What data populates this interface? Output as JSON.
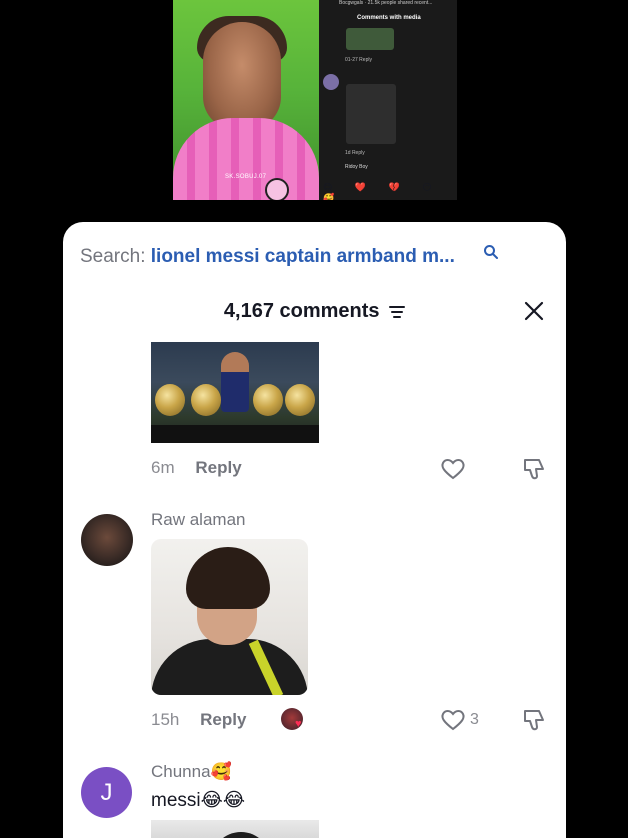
{
  "video": {
    "watermark": "SK.SOBUJ.07",
    "right_panel": {
      "top_text": "Bocgwgals · 21.5k people shared recent...",
      "title": "Comments with media",
      "meta_1": "01-27   Reply",
      "meta_2": "1d   Reply",
      "emoji_row": "😊 ❤️ 💔 😶 🥰",
      "input_text": "Ridoy Boy"
    }
  },
  "search": {
    "label": "Search:",
    "query": "lionel messi captain armband m..."
  },
  "header": {
    "comment_count": "4,167 comments"
  },
  "comments": [
    {
      "time": "6m",
      "reply_label": "Reply"
    },
    {
      "username": "Raw alaman",
      "time": "15h",
      "reply_label": "Reply",
      "like_count": "3"
    },
    {
      "username": "Chunna🥰",
      "avatar_letter": "J",
      "text": "messi😂😂"
    }
  ],
  "colors": {
    "query_blue": "#2b5db2",
    "avatar_purple": "#7a4fc4",
    "heart_red": "#fe2c55"
  }
}
